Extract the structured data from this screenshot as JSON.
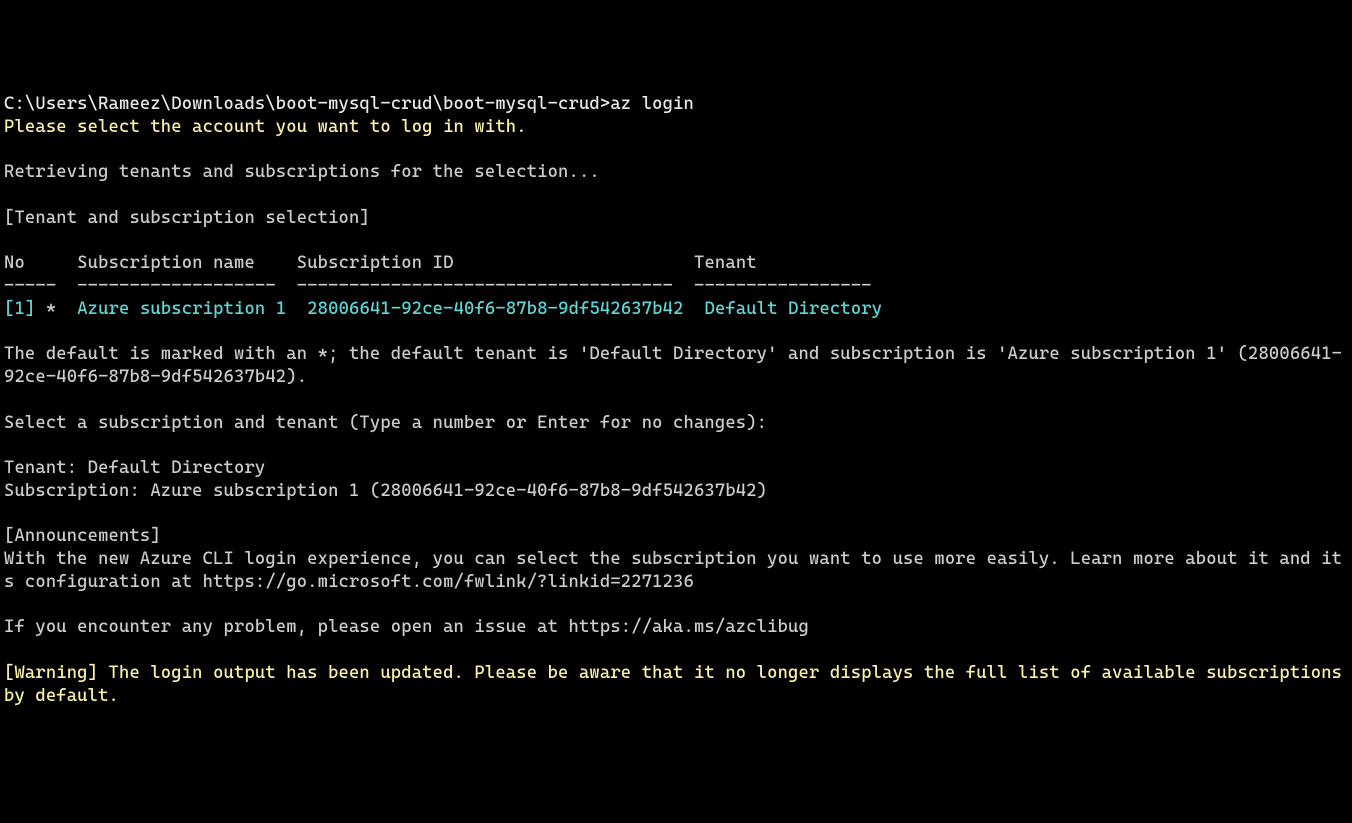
{
  "prompt": {
    "path": "C:\\Users\\Rameez\\Downloads\\boot-mysql-crud\\boot-mysql-crud>",
    "command": "az login"
  },
  "select_msg": "Please select the account you want to log in with.",
  "retrieving": "Retrieving tenants and subscriptions for the selection...",
  "section_header": "[Tenant and subscription selection]",
  "table": {
    "headers": {
      "no": "No",
      "name": "Subscription name",
      "id": "Subscription ID",
      "tenant": "Tenant"
    },
    "divider": {
      "no": "-----",
      "name": "-------------------",
      "id": "------------------------------------",
      "tenant": "-----------------"
    },
    "row": {
      "no": "[1]",
      "star": " *",
      "spacer": "  ",
      "name": "Azure subscription 1",
      "name_pad": "  ",
      "id": "28006641-92ce-40f6-87b8-9df542637b42",
      "id_pad": "  ",
      "tenant": "Default Directory"
    }
  },
  "default_msg": "The default is marked with an *; the default tenant is 'Default Directory' and subscription is 'Azure subscription 1' (28006641-92ce-40f6-87b8-9df542637b42).",
  "select_prompt": "Select a subscription and tenant (Type a number or Enter for no changes):",
  "tenant_line": "Tenant: Default Directory",
  "subscription_line": "Subscription: Azure subscription 1 (28006641-92ce-40f6-87b8-9df542637b42)",
  "announcements_header": "[Announcements]",
  "announcement_text": "With the new Azure CLI login experience, you can select the subscription you want to use more easily. Learn more about it and its configuration at https://go.microsoft.com/fwlink/?linkid=2271236",
  "issue_text": "If you encounter any problem, please open an issue at https://aka.ms/azclibug",
  "warning_text": "[Warning] The login output has been updated. Please be aware that it no longer displays the full list of available subscriptions by default."
}
